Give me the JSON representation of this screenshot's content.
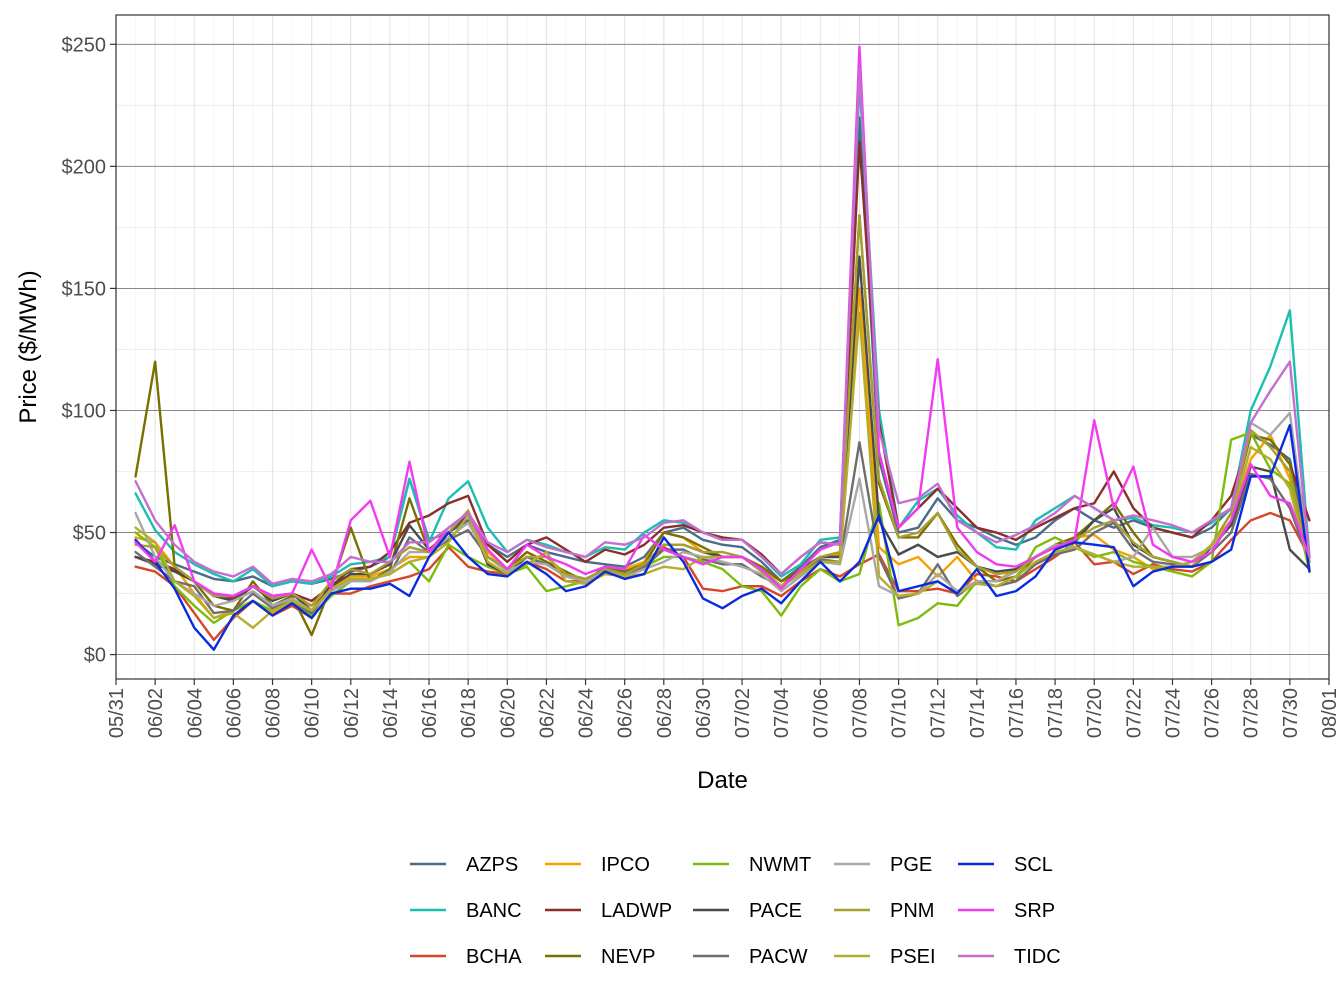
{
  "chart_data": {
    "type": "line",
    "xlabel": "Date",
    "ylabel": "Price ($/MWh)",
    "ylim": [
      -10,
      262
    ],
    "yticks": [
      0,
      50,
      100,
      150,
      200,
      250
    ],
    "ytick_labels": [
      "$0",
      "$50",
      "$100",
      "$150",
      "$200",
      "$250"
    ],
    "xlim": [
      "05/31",
      "08/01"
    ],
    "xtick_labels": [
      "05/31",
      "06/02",
      "06/04",
      "06/06",
      "06/08",
      "06/10",
      "06/12",
      "06/14",
      "06/16",
      "06/18",
      "06/20",
      "06/22",
      "06/24",
      "06/26",
      "06/28",
      "06/30",
      "07/02",
      "07/04",
      "07/06",
      "07/08",
      "07/10",
      "07/12",
      "07/14",
      "07/16",
      "07/18",
      "07/20",
      "07/22",
      "07/24",
      "07/26",
      "07/28",
      "07/30",
      "08/01"
    ],
    "x": [
      "06/01",
      "06/02",
      "06/03",
      "06/04",
      "06/05",
      "06/06",
      "06/07",
      "06/08",
      "06/09",
      "06/10",
      "06/11",
      "06/12",
      "06/13",
      "06/14",
      "06/15",
      "06/16",
      "06/17",
      "06/18",
      "06/19",
      "06/20",
      "06/21",
      "06/22",
      "06/23",
      "06/24",
      "06/25",
      "06/26",
      "06/27",
      "06/28",
      "06/29",
      "06/30",
      "07/01",
      "07/02",
      "07/03",
      "07/04",
      "07/05",
      "07/06",
      "07/07",
      "07/08",
      "07/09",
      "07/10",
      "07/11",
      "07/12",
      "07/13",
      "07/14",
      "07/15",
      "07/16",
      "07/17",
      "07/18",
      "07/19",
      "07/20",
      "07/21",
      "07/22",
      "07/23",
      "07/24",
      "07/25",
      "07/26",
      "07/27",
      "07/28",
      "07/29",
      "07/30",
      "07/31"
    ],
    "grid": true,
    "legend_position": "bottom",
    "series": [
      {
        "name": "AZPS",
        "color": "#4a6b8a",
        "values": [
          46,
          40,
          37,
          34,
          31,
          30,
          32,
          28,
          30,
          29,
          31,
          34,
          36,
          40,
          72,
          47,
          50,
          55,
          45,
          40,
          45,
          42,
          40,
          38,
          37,
          36,
          40,
          50,
          52,
          47,
          45,
          44,
          38,
          30,
          36,
          44,
          47,
          220,
          80,
          50,
          52,
          64,
          55,
          52,
          48,
          45,
          48,
          55,
          60,
          55,
          52,
          55,
          52,
          50,
          48,
          52,
          60,
          90,
          86,
          80,
          40
        ]
      },
      {
        "name": "BANC",
        "color": "#19c0b0",
        "values": [
          66,
          51,
          42,
          37,
          33,
          30,
          35,
          28,
          30,
          29,
          32,
          37,
          38,
          40,
          72,
          46,
          64,
          71,
          52,
          42,
          47,
          45,
          42,
          40,
          44,
          43,
          50,
          55,
          54,
          50,
          47,
          47,
          40,
          32,
          37,
          47,
          48,
          235,
          100,
          52,
          63,
          68,
          57,
          50,
          44,
          43,
          55,
          60,
          65,
          60,
          55,
          56,
          53,
          52,
          50,
          54,
          60,
          100,
          118,
          141,
          40
        ]
      },
      {
        "name": "BCHA",
        "color": "#d4472a",
        "values": [
          36,
          34,
          28,
          17,
          6,
          15,
          22,
          16,
          20,
          15,
          25,
          25,
          28,
          30,
          32,
          35,
          44,
          36,
          34,
          33,
          38,
          35,
          30,
          30,
          34,
          32,
          35,
          44,
          40,
          27,
          26,
          28,
          28,
          24,
          30,
          35,
          32,
          37,
          41,
          26,
          26,
          27,
          25,
          33,
          32,
          30,
          35,
          40,
          46,
          37,
          38,
          33,
          37,
          35,
          34,
          38,
          47,
          55,
          58,
          55,
          40
        ]
      },
      {
        "name": "IPCO",
        "color": "#f5a100",
        "values": [
          48,
          46,
          36,
          25,
          15,
          18,
          22,
          17,
          22,
          20,
          27,
          32,
          32,
          35,
          40,
          40,
          50,
          58,
          42,
          35,
          42,
          38,
          33,
          30,
          36,
          35,
          38,
          50,
          48,
          42,
          40,
          40,
          35,
          30,
          33,
          40,
          41,
          150,
          44,
          37,
          40,
          32,
          40,
          30,
          30,
          35,
          40,
          45,
          48,
          49,
          43,
          40,
          35,
          36,
          38,
          45,
          55,
          80,
          90,
          72,
          40
        ]
      },
      {
        "name": "LADWP",
        "color": "#8b2f2a",
        "values": [
          40,
          38,
          35,
          30,
          25,
          23,
          28,
          24,
          25,
          22,
          28,
          35,
          36,
          42,
          54,
          57,
          62,
          65,
          45,
          38,
          45,
          48,
          43,
          38,
          43,
          41,
          45,
          52,
          53,
          50,
          48,
          47,
          41,
          33,
          40,
          46,
          45,
          210,
          95,
          52,
          60,
          68,
          60,
          52,
          50,
          47,
          52,
          56,
          60,
          62,
          75,
          60,
          52,
          50,
          48,
          55,
          65,
          90,
          88,
          78,
          55
        ]
      },
      {
        "name": "NEVP",
        "color": "#7a7000",
        "values": [
          73,
          120,
          36,
          30,
          20,
          18,
          30,
          20,
          24,
          8,
          28,
          52,
          30,
          35,
          64,
          42,
          50,
          58,
          40,
          35,
          42,
          38,
          34,
          30,
          36,
          34,
          37,
          50,
          48,
          44,
          40,
          40,
          36,
          30,
          35,
          40,
          40,
          180,
          70,
          48,
          48,
          58,
          45,
          36,
          30,
          32,
          40,
          45,
          48,
          55,
          62,
          50,
          40,
          38,
          36,
          45,
          58,
          90,
          88,
          78,
          34
        ]
      },
      {
        "name": "NWMT",
        "color": "#7cbc0a",
        "values": [
          50,
          44,
          28,
          20,
          13,
          18,
          22,
          18,
          22,
          16,
          24,
          30,
          31,
          33,
          38,
          30,
          45,
          40,
          36,
          33,
          36,
          26,
          28,
          30,
          35,
          33,
          36,
          40,
          40,
          38,
          35,
          28,
          26,
          16,
          28,
          35,
          30,
          33,
          62,
          12,
          15,
          21,
          20,
          30,
          28,
          30,
          44,
          48,
          44,
          40,
          42,
          38,
          36,
          34,
          32,
          38,
          88,
          91,
          76,
          70,
          34
        ]
      },
      {
        "name": "PACE",
        "color": "#4a4a4a",
        "values": [
          40,
          37,
          34,
          30,
          24,
          22,
          28,
          22,
          25,
          18,
          28,
          33,
          33,
          37,
          53,
          43,
          50,
          57,
          37,
          33,
          40,
          37,
          33,
          31,
          35,
          33,
          37,
          45,
          45,
          42,
          40,
          40,
          35,
          28,
          35,
          40,
          40,
          163,
          55,
          41,
          45,
          40,
          42,
          36,
          34,
          35,
          40,
          44,
          46,
          55,
          60,
          45,
          40,
          38,
          36,
          44,
          53,
          77,
          75,
          43,
          35
        ]
      },
      {
        "name": "PACW",
        "color": "#6e6e6e",
        "values": [
          42,
          36,
          30,
          28,
          17,
          18,
          25,
          19,
          22,
          17,
          27,
          30,
          31,
          33,
          48,
          42,
          47,
          51,
          40,
          35,
          40,
          37,
          32,
          30,
          34,
          32,
          36,
          43,
          43,
          39,
          37,
          37,
          32,
          28,
          33,
          39,
          38,
          87,
          40,
          23,
          25,
          37,
          24,
          30,
          28,
          30,
          37,
          41,
          43,
          50,
          54,
          43,
          38,
          37,
          36,
          42,
          50,
          74,
          72,
          60,
          38
        ]
      },
      {
        "name": "PGE",
        "color": "#a8a8a8",
        "values": [
          58,
          40,
          30,
          25,
          20,
          22,
          26,
          20,
          23,
          18,
          26,
          30,
          30,
          34,
          42,
          42,
          48,
          54,
          40,
          34,
          38,
          37,
          32,
          30,
          34,
          32,
          35,
          38,
          42,
          40,
          38,
          36,
          33,
          26,
          32,
          38,
          37,
          72,
          28,
          24,
          25,
          33,
          26,
          30,
          30,
          34,
          40,
          45,
          44,
          41,
          38,
          40,
          52,
          40,
          40,
          44,
          55,
          95,
          90,
          99,
          38
        ]
      },
      {
        "name": "PNM",
        "color": "#a7a030",
        "values": [
          45,
          44,
          36,
          30,
          24,
          24,
          28,
          23,
          25,
          20,
          30,
          35,
          33,
          38,
          44,
          42,
          50,
          59,
          40,
          35,
          40,
          40,
          33,
          31,
          35,
          33,
          37,
          45,
          45,
          42,
          42,
          40,
          34,
          28,
          34,
          40,
          42,
          180,
          72,
          48,
          50,
          58,
          43,
          36,
          33,
          34,
          40,
          44,
          47,
          52,
          55,
          46,
          40,
          38,
          36,
          45,
          58,
          92,
          85,
          75,
          38
        ]
      },
      {
        "name": "PSEI",
        "color": "#b5ad2c",
        "values": [
          52,
          46,
          30,
          24,
          15,
          17,
          11,
          18,
          22,
          18,
          27,
          31,
          31,
          33,
          38,
          40,
          46,
          57,
          38,
          33,
          37,
          42,
          30,
          29,
          33,
          32,
          33,
          36,
          35,
          40,
          40,
          40,
          35,
          28,
          33,
          38,
          38,
          140,
          32,
          24,
          25,
          30,
          25,
          29,
          28,
          32,
          38,
          42,
          44,
          41,
          38,
          36,
          36,
          36,
          38,
          45,
          55,
          85,
          80,
          68,
          36
        ]
      },
      {
        "name": "SCL",
        "color": "#0a2ae0",
        "values": [
          47,
          38,
          27,
          11,
          2,
          16,
          22,
          16,
          21,
          15,
          25,
          27,
          27,
          29,
          24,
          40,
          50,
          40,
          33,
          32,
          38,
          33,
          26,
          28,
          34,
          31,
          33,
          48,
          38,
          23,
          19,
          24,
          27,
          21,
          30,
          38,
          30,
          38,
          57,
          26,
          28,
          30,
          25,
          35,
          24,
          26,
          32,
          43,
          46,
          45,
          44,
          28,
          34,
          36,
          36,
          38,
          43,
          73,
          73,
          94,
          34
        ]
      },
      {
        "name": "SRP",
        "color": "#f23af2",
        "values": [
          46,
          38,
          53,
          30,
          25,
          24,
          28,
          24,
          25,
          43,
          27,
          55,
          63,
          40,
          79,
          42,
          52,
          58,
          43,
          35,
          45,
          40,
          37,
          33,
          36,
          35,
          49,
          43,
          40,
          37,
          40,
          40,
          35,
          27,
          35,
          43,
          46,
          249,
          83,
          52,
          60,
          121,
          52,
          42,
          37,
          36,
          40,
          44,
          47,
          96,
          60,
          77,
          45,
          40,
          38,
          42,
          55,
          78,
          65,
          62,
          40
        ]
      },
      {
        "name": "TIDC",
        "color": "#c46ed0",
        "values": [
          71,
          55,
          45,
          38,
          34,
          32,
          36,
          29,
          31,
          30,
          33,
          40,
          38,
          38,
          46,
          46,
          52,
          58,
          46,
          42,
          47,
          44,
          42,
          40,
          46,
          45,
          48,
          54,
          55,
          50,
          47,
          47,
          40,
          33,
          40,
          46,
          45,
          240,
          92,
          62,
          64,
          70,
          55,
          50,
          46,
          49,
          53,
          58,
          65,
          60,
          55,
          57,
          55,
          53,
          50,
          55,
          60,
          95,
          108,
          120,
          40
        ]
      }
    ]
  }
}
